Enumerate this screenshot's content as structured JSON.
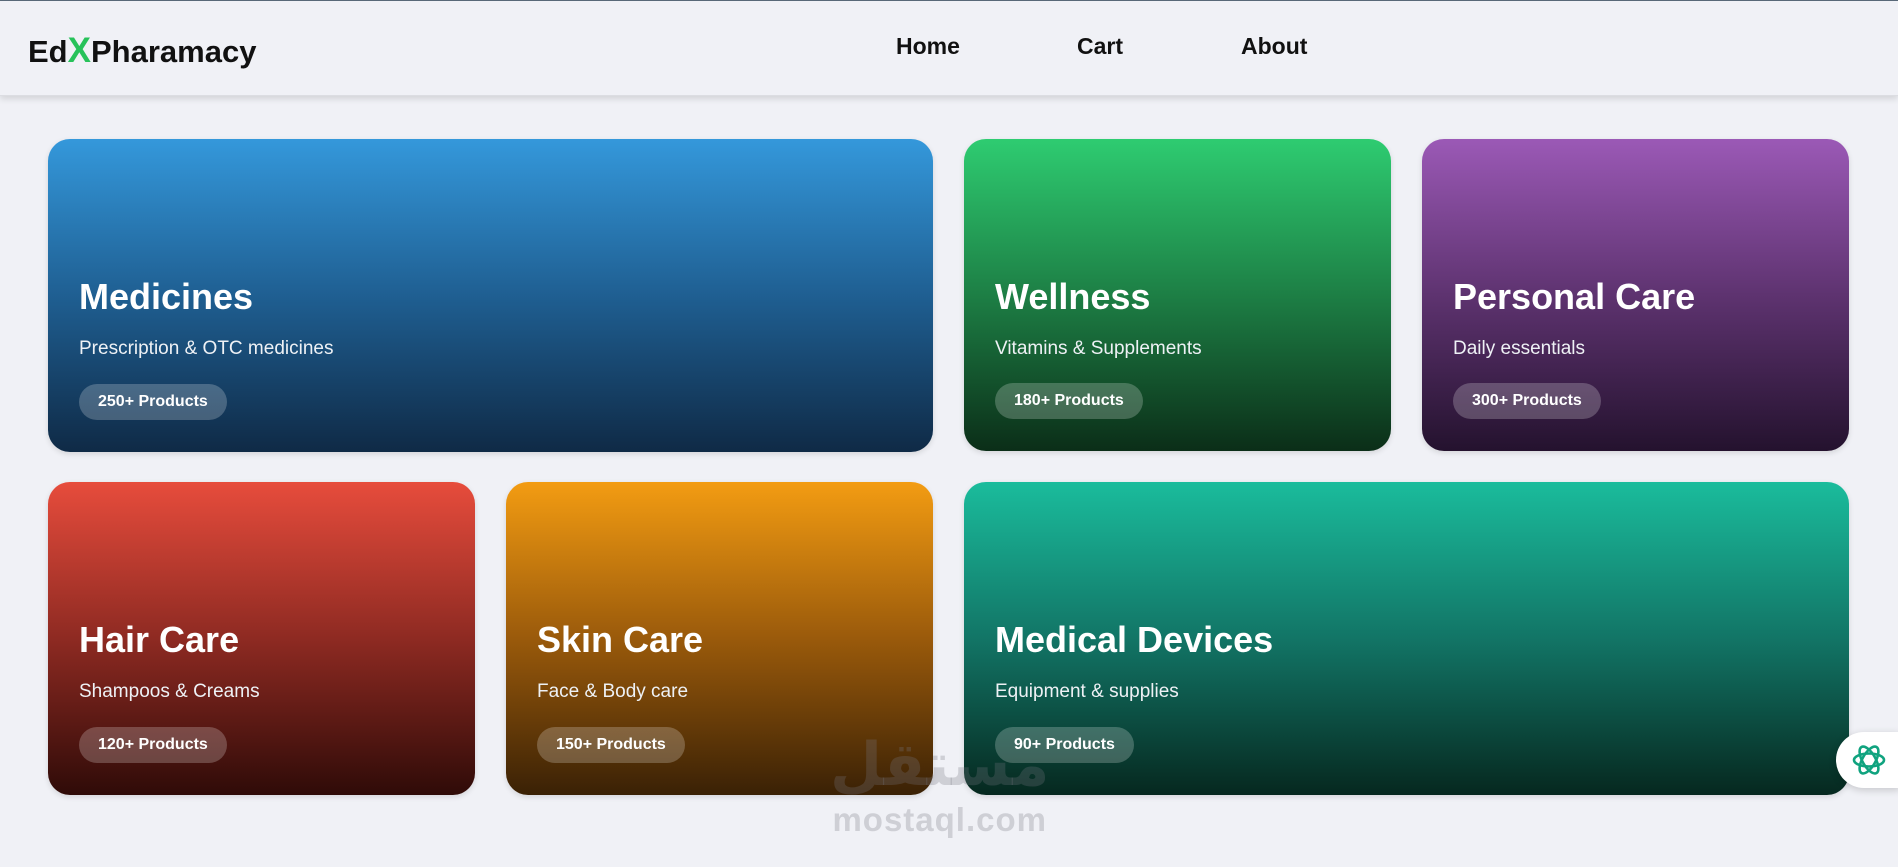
{
  "brand": {
    "prefix": "Ed",
    "x": "X",
    "suffix": "Pharamacy"
  },
  "nav": {
    "home": "Home",
    "cart": "Cart",
    "about": "About"
  },
  "categories": [
    {
      "title": "Medicines",
      "subtitle": "Prescription & OTC medicines",
      "badge": "250+ Products",
      "color": "#3498db"
    },
    {
      "title": "Wellness",
      "subtitle": "Vitamins & Supplements",
      "badge": "180+ Products",
      "color": "#2ecc71"
    },
    {
      "title": "Personal Care",
      "subtitle": "Daily essentials",
      "badge": "300+ Products",
      "color": "#9b59b6"
    },
    {
      "title": "Hair Care",
      "subtitle": "Shampoos & Creams",
      "badge": "120+ Products",
      "color": "#e74c3c"
    },
    {
      "title": "Skin Care",
      "subtitle": "Face & Body care",
      "badge": "150+ Products",
      "color": "#f39c12"
    },
    {
      "title": "Medical Devices",
      "subtitle": "Equipment & supplies",
      "badge": "90+ Products",
      "color": "#1abc9c"
    }
  ],
  "watermark": {
    "arabic": "مستقل",
    "latin": "mostaql.com"
  },
  "icons": {
    "assistant": "assistant-logo-icon"
  }
}
